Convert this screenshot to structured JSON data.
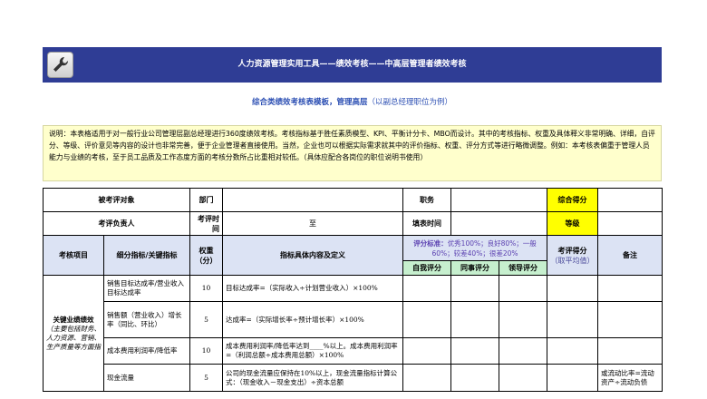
{
  "banner": {
    "title": "人力资源管理实用工具——绩效考核——中高层管理者绩效考核",
    "icon": "wrench-icon"
  },
  "subtitle": {
    "main": "综合类绩效考核表模板，管理高层",
    "paren": "（以副总经理职位为例）"
  },
  "note": "说明：本表格适用于对一般行业公司管理层副总经理进行360度绩效考核。考核指标基于胜任素质模型、KPI、平衡计分卡、MBO而设计。其中的考核指标、权重及具体释义非常明确、详细，自评分、等级、评价意见等内容的设计也非常完善，便于企业管理者直接使用。当然，企业也可以根据实际需求就其中的评价指标、权重、评分方式等进行略微调整。例如：本考核表偏重于管理人员能力与业绩的考核，至于员工品质及工作态度方面的考核分数所占比重相对较低。（具体应配合各岗位的职位说明书使用）",
  "form": {
    "examinee": "被考评对象",
    "department": "部门",
    "position": "职务",
    "total_score": "综合得分",
    "owner": "考评负责人",
    "period": "考评时间",
    "to": "至",
    "fill_date": "填表时间",
    "grade": "等级"
  },
  "header": {
    "item": "考核项目",
    "indicator": "细分指标/关键指标",
    "weight": "权重（分）",
    "definition": "指标具体内容及定义",
    "scale": "评分标准：优秀100%；良好80%；一般60%；较差40%；很差20%",
    "scale_prefix": "评分标准：",
    "scale_rest": "优秀100%；良好80%；一般60%；较差40%；很差20%",
    "self": "自我评分",
    "peer": "同事评分",
    "leader": "领导评分",
    "final": "考评得分",
    "final_hint": "（取平均值）",
    "remark": "备注"
  },
  "category": {
    "name": "关键业绩绩效",
    "desc": "（主要包括财务、人力资源、营销、生产质量等方面指"
  },
  "rows": [
    {
      "indicator": "销售目标达成率/营业收入目标达成率",
      "weight": "10",
      "definition": "目标达成率=（实际收入÷计划营业收入）×100%",
      "remark": ""
    },
    {
      "indicator": "销售额（营业收入）增长率（同比、环比）",
      "weight": "5",
      "definition": "达成率=（实际增长率÷预计增长率）×100%",
      "remark": ""
    },
    {
      "indicator": "成本费用利润率/降低率",
      "weight": "10",
      "definition": "成本费用利润率/降低率达到____%以上。成本费用利润率=（利润总额÷成本费用总额）×100%",
      "remark": ""
    },
    {
      "indicator": "现金流量",
      "weight": "5",
      "definition": "公司的现金流量应保持在10%以上，现金流量指标计算公式：（现金收入－现金支出）÷资本总额",
      "remark": "或流动比率=流动资产÷流动负债"
    }
  ]
}
